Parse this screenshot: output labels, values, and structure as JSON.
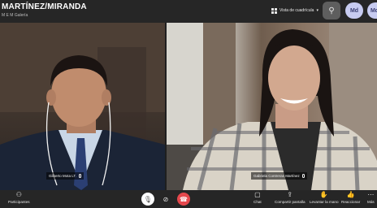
{
  "header": {
    "title": "MARTÍNEZ/MIRANDA",
    "subtitle": "M E M Galería",
    "view_label": "Vista de cuadrícula",
    "add_people_icon": "add-person-icon",
    "avatars": [
      "Md",
      "Md"
    ]
  },
  "participants": [
    {
      "name": "Gilberto Mota LT.",
      "icon": "mic-icon"
    },
    {
      "name": "Gabriela Contreras Martínez",
      "icon": "mic-icon"
    }
  ],
  "toolbar": {
    "participants_label": "Participantes",
    "chat_label": "Chat",
    "share_label": "Compartir pantalla",
    "raise_hand_label": "Levantar la mano",
    "react_label": "Reaccionar",
    "more_label": "Más"
  },
  "colors": {
    "end_call": "#e5484d",
    "top_bar": "#262626",
    "toolbar": "#262626",
    "avatar_bg": "#c7cbf0",
    "reaction": "#f2b233"
  }
}
